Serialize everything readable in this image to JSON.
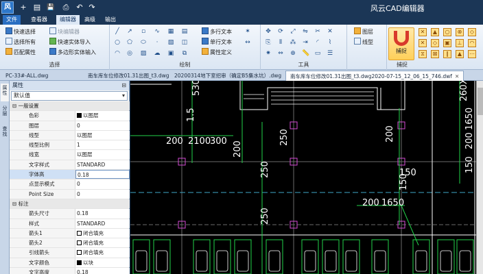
{
  "app": {
    "logo": "风",
    "title": "风云CAD编辑器"
  },
  "quick_access": [
    "+",
    "▤",
    "💾",
    "⎙",
    "↶",
    "↷"
  ],
  "ribbon_tabs": [
    "文件",
    "查看器",
    "编辑器",
    "高级",
    "输出"
  ],
  "ribbon": {
    "select_group": {
      "label": "选择",
      "items": [
        "快速选择",
        "块编辑器",
        "选择所有",
        "快速实体导入",
        "匹配属性",
        "多边形实体输入"
      ]
    },
    "draw_group": {
      "label": "绘制",
      "text_items": [
        "多行文本",
        "单行文本",
        "属性定义"
      ]
    },
    "tools_group": {
      "label": "工具"
    },
    "layer_group": {
      "items": [
        "图层",
        "线型"
      ]
    },
    "snap_group": {
      "label": "捕捉",
      "button": "捕捉"
    }
  },
  "doc_tabs": [
    {
      "label": "PC-33#-ALL.dwg",
      "closable": false
    },
    {
      "label": "南车库车位修改01.31出图_t3.dwg",
      "closable": false
    },
    {
      "label": "20200314地下室招审（确定B5集水坑）.dwg",
      "closable": false
    },
    {
      "label": "南车库车位修改01.31出图_t3.dwg2020-07-15_12_06_15_746.dwf",
      "closable": true,
      "close": "✕"
    }
  ],
  "side_tabs": [
    "属性",
    "分层",
    "查找"
  ],
  "properties": {
    "header": "属性",
    "pin": "⊟",
    "selector": "默认值",
    "rows": [
      {
        "type": "section",
        "k": "⊟ 一般设置"
      },
      {
        "k": "色彩",
        "v": "以图层",
        "swatch": true
      },
      {
        "k": "图层",
        "v": "0"
      },
      {
        "k": "线型",
        "v": "以图层"
      },
      {
        "k": "线型比例",
        "v": "1"
      },
      {
        "k": "线宽",
        "v": "以图层"
      },
      {
        "k": "文字样式",
        "v": "STANDARD"
      },
      {
        "k": "字体高",
        "v": "0.18",
        "selected": true
      },
      {
        "k": "点显示模式",
        "v": "0"
      },
      {
        "k": "Point Size",
        "v": "0"
      },
      {
        "type": "section",
        "k": "⊟ 标注"
      },
      {
        "k": "箭头尺寸",
        "v": "0.18"
      },
      {
        "k": "样式",
        "v": "STANDARD"
      },
      {
        "k": "箭头1",
        "v": "闭合填充",
        "arrow": true
      },
      {
        "k": "箭头2",
        "v": "闭合填充",
        "arrow": true
      },
      {
        "k": "引线箭头",
        "v": "闭合填充",
        "arrow": true
      },
      {
        "k": "文字颜色",
        "v": "以块",
        "swatch": true
      },
      {
        "k": "文字高度",
        "v": "0.18"
      }
    ]
  },
  "drawing": {
    "dims": [
      "530",
      "1.5",
      "200",
      "2100",
      "300",
      "200",
      "250",
      "250",
      "150",
      "200",
      "1650",
      "150",
      "260X",
      "1650",
      "200",
      "150",
      "200",
      "250"
    ]
  }
}
